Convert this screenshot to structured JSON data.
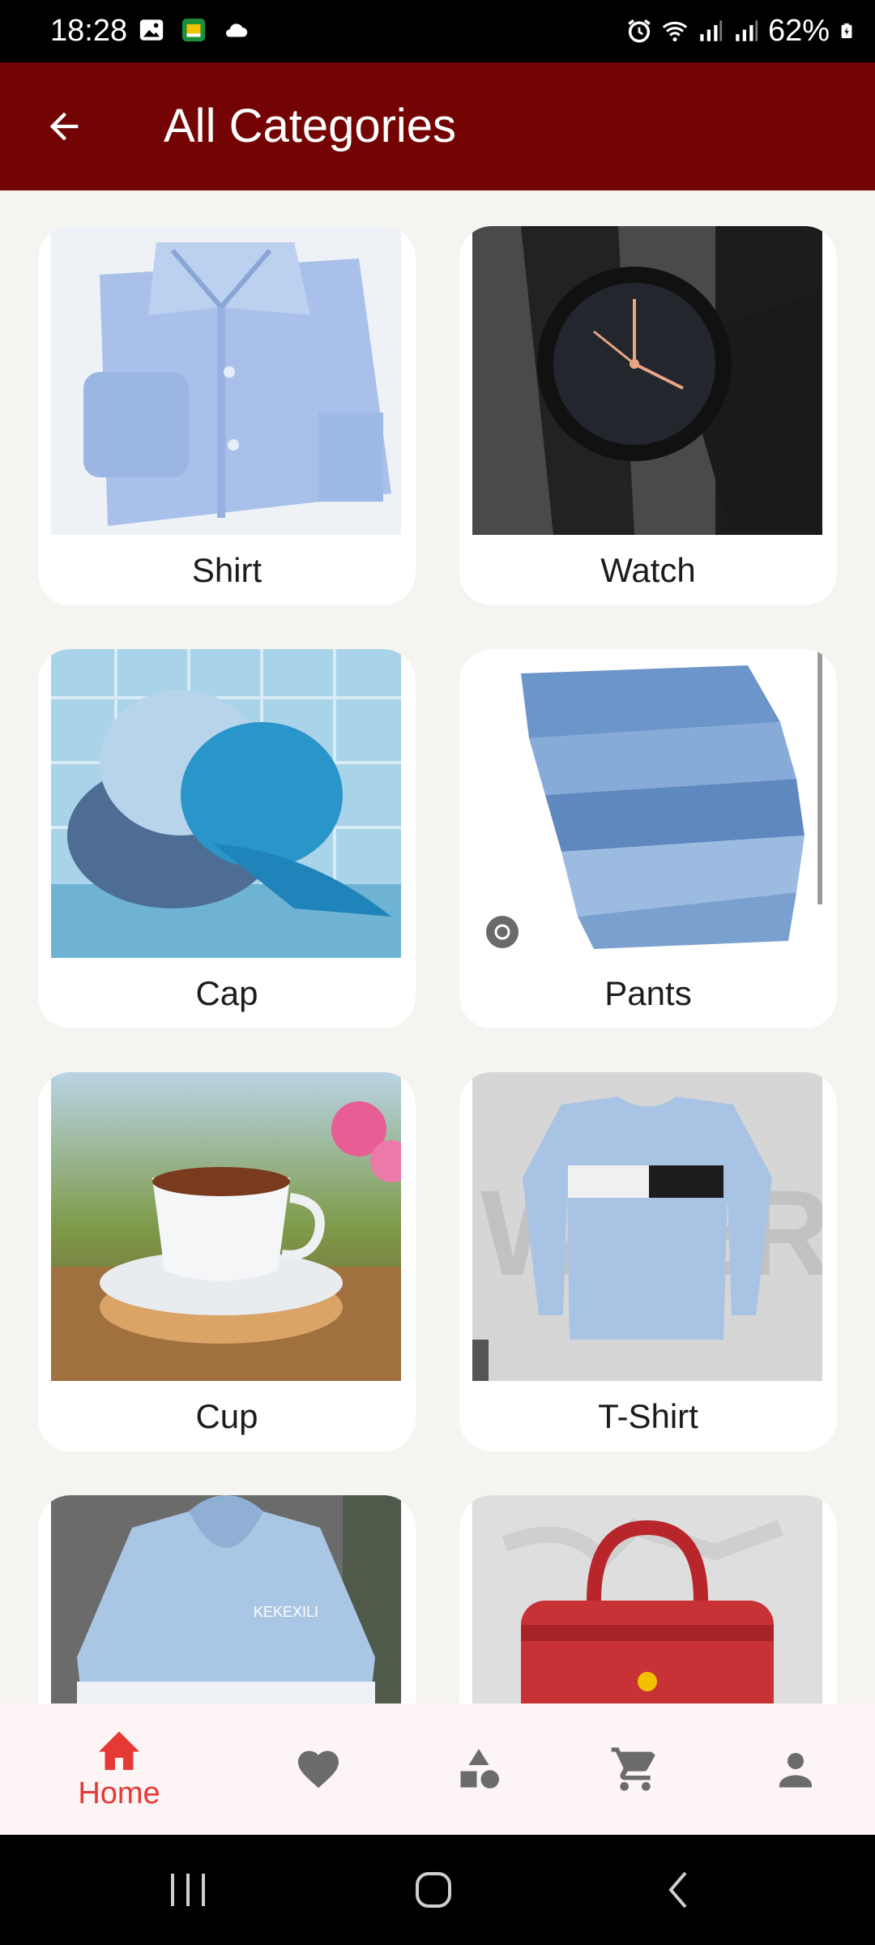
{
  "status_bar": {
    "time": "18:28",
    "battery": "62%",
    "icons": [
      "gallery-icon",
      "app-icon",
      "cloud-icon",
      "alarm-icon",
      "wifi-icon",
      "signal-icon",
      "signal-icon",
      "battery-icon"
    ]
  },
  "app_bar": {
    "back_icon": "arrow-left-icon",
    "title": "All Categories"
  },
  "categories": [
    {
      "label": "Shirt",
      "image": "blue folded shirt"
    },
    {
      "label": "Watch",
      "image": "black wrist watch"
    },
    {
      "label": "Cap",
      "image": "blue caps"
    },
    {
      "label": "Pants",
      "image": "stack of jeans"
    },
    {
      "label": "Cup",
      "image": "tea cup on saucer"
    },
    {
      "label": "T-Shirt",
      "image": "long sleeve t-shirt"
    },
    {
      "label": "",
      "image": "hoodie"
    },
    {
      "label": "",
      "image": "red bag"
    }
  ],
  "bottom_nav": {
    "active": "Home",
    "active_color": "#e53935",
    "inactive_color": "#6b6b6b",
    "items": [
      {
        "icon": "home-icon",
        "label": "Home"
      },
      {
        "icon": "heart-icon",
        "label": ""
      },
      {
        "icon": "categories-icon",
        "label": ""
      },
      {
        "icon": "cart-icon",
        "label": ""
      },
      {
        "icon": "person-icon",
        "label": ""
      }
    ]
  },
  "colors": {
    "app_bar": "#740404",
    "background": "#f5f4f1",
    "card": "#ffffff"
  }
}
